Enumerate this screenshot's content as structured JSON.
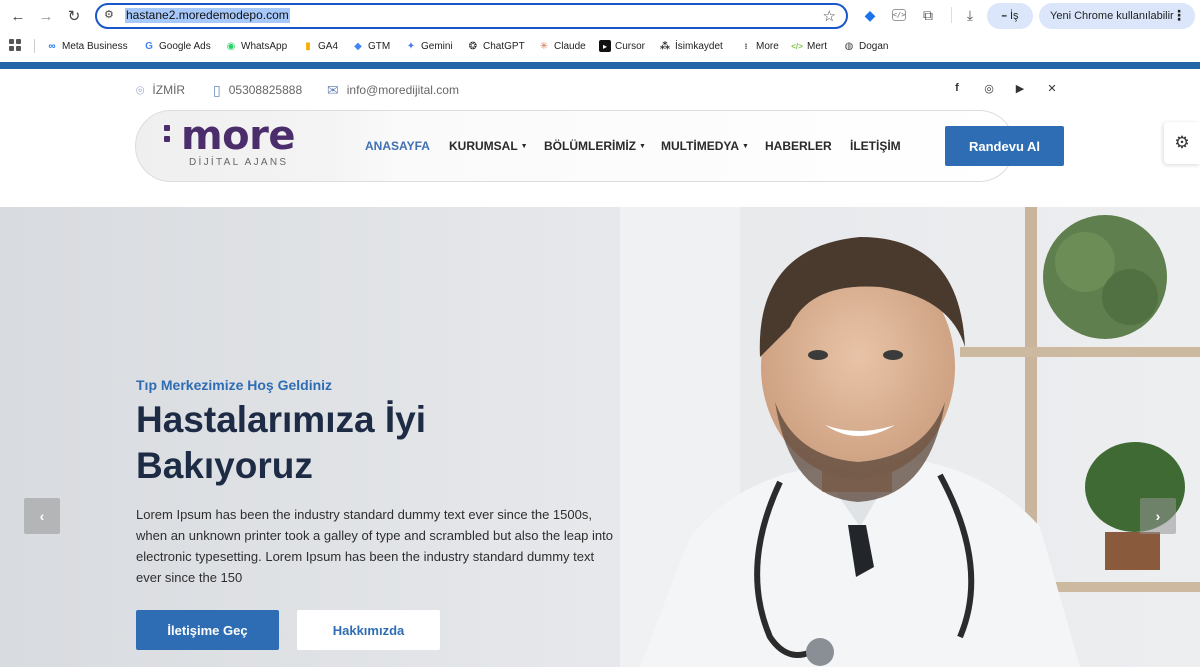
{
  "browser": {
    "url": "hastane2.moredemodepo.com",
    "profile_label": "İş",
    "update_label": "Yeni Chrome kullanılabilir"
  },
  "bookmarks": [
    {
      "label": "Meta Business",
      "icon": "meta-icon",
      "color": "#1877f2"
    },
    {
      "label": "Google Ads",
      "icon": "google-icon",
      "color": "#4285f4"
    },
    {
      "label": "WhatsApp",
      "icon": "whatsapp-icon",
      "color": "#25d366"
    },
    {
      "label": "GA4",
      "icon": "analytics-icon",
      "color": "#f9ab00"
    },
    {
      "label": "GTM",
      "icon": "tag-manager-icon",
      "color": "#4285f4"
    },
    {
      "label": "Gemini",
      "icon": "gemini-icon",
      "color": "#4b7bec"
    },
    {
      "label": "ChatGPT",
      "icon": "chatgpt-icon",
      "color": "#222222"
    },
    {
      "label": "Claude",
      "icon": "claude-icon",
      "color": "#d97757"
    },
    {
      "label": "Cursor",
      "icon": "cursor-icon",
      "color": "#111111"
    },
    {
      "label": "İsimkaydet",
      "icon": "isimkaydet-icon",
      "color": "#333333"
    },
    {
      "label": "More",
      "icon": "more-folder-icon",
      "color": "#555555"
    },
    {
      "label": "Mert",
      "icon": "code-icon",
      "color": "#7cc24a"
    },
    {
      "label": "Dogan",
      "icon": "globe-icon",
      "color": "#444444"
    }
  ],
  "site": {
    "contact": {
      "city": "İZMİR",
      "phone": "05308825888",
      "email": "info@moredijital.com"
    },
    "social": [
      "facebook-icon",
      "instagram-icon",
      "youtube-icon",
      "twitter-icon"
    ],
    "logo": {
      "name": "more",
      "tagline": "DİJİTAL AJANS"
    },
    "menu": [
      {
        "label": "ANASAYFA",
        "active": true,
        "dropdown": false
      },
      {
        "label": "KURUMSAL",
        "active": false,
        "dropdown": true
      },
      {
        "label": "BÖLÜMLERİMİZ",
        "active": false,
        "dropdown": true
      },
      {
        "label": "MULTİMEDYA",
        "active": false,
        "dropdown": true
      },
      {
        "label": "HABERLER",
        "active": false,
        "dropdown": false
      },
      {
        "label": "İLETİŞİM",
        "active": false,
        "dropdown": false
      }
    ],
    "cta_label": "Randevu Al",
    "colors": {
      "brand_blue": "#2e6db4",
      "logo_purple": "#4a2d6a",
      "title_navy": "#1e2b45"
    }
  },
  "hero": {
    "eyebrow": "Tıp Merkezimize Hoş Geldiniz",
    "title": "Hastalarımıza İyi Bakıyoruz",
    "text": "Lorem Ipsum has been the industry standard dummy text ever since the 1500s, when an unknown printer took a galley of type and scrambled but also the leap into electronic typesetting. Lorem Ipsum has been the industry standard dummy text ever since the 150",
    "primary_button": "İletişime Geç",
    "secondary_button": "Hakkımızda"
  }
}
